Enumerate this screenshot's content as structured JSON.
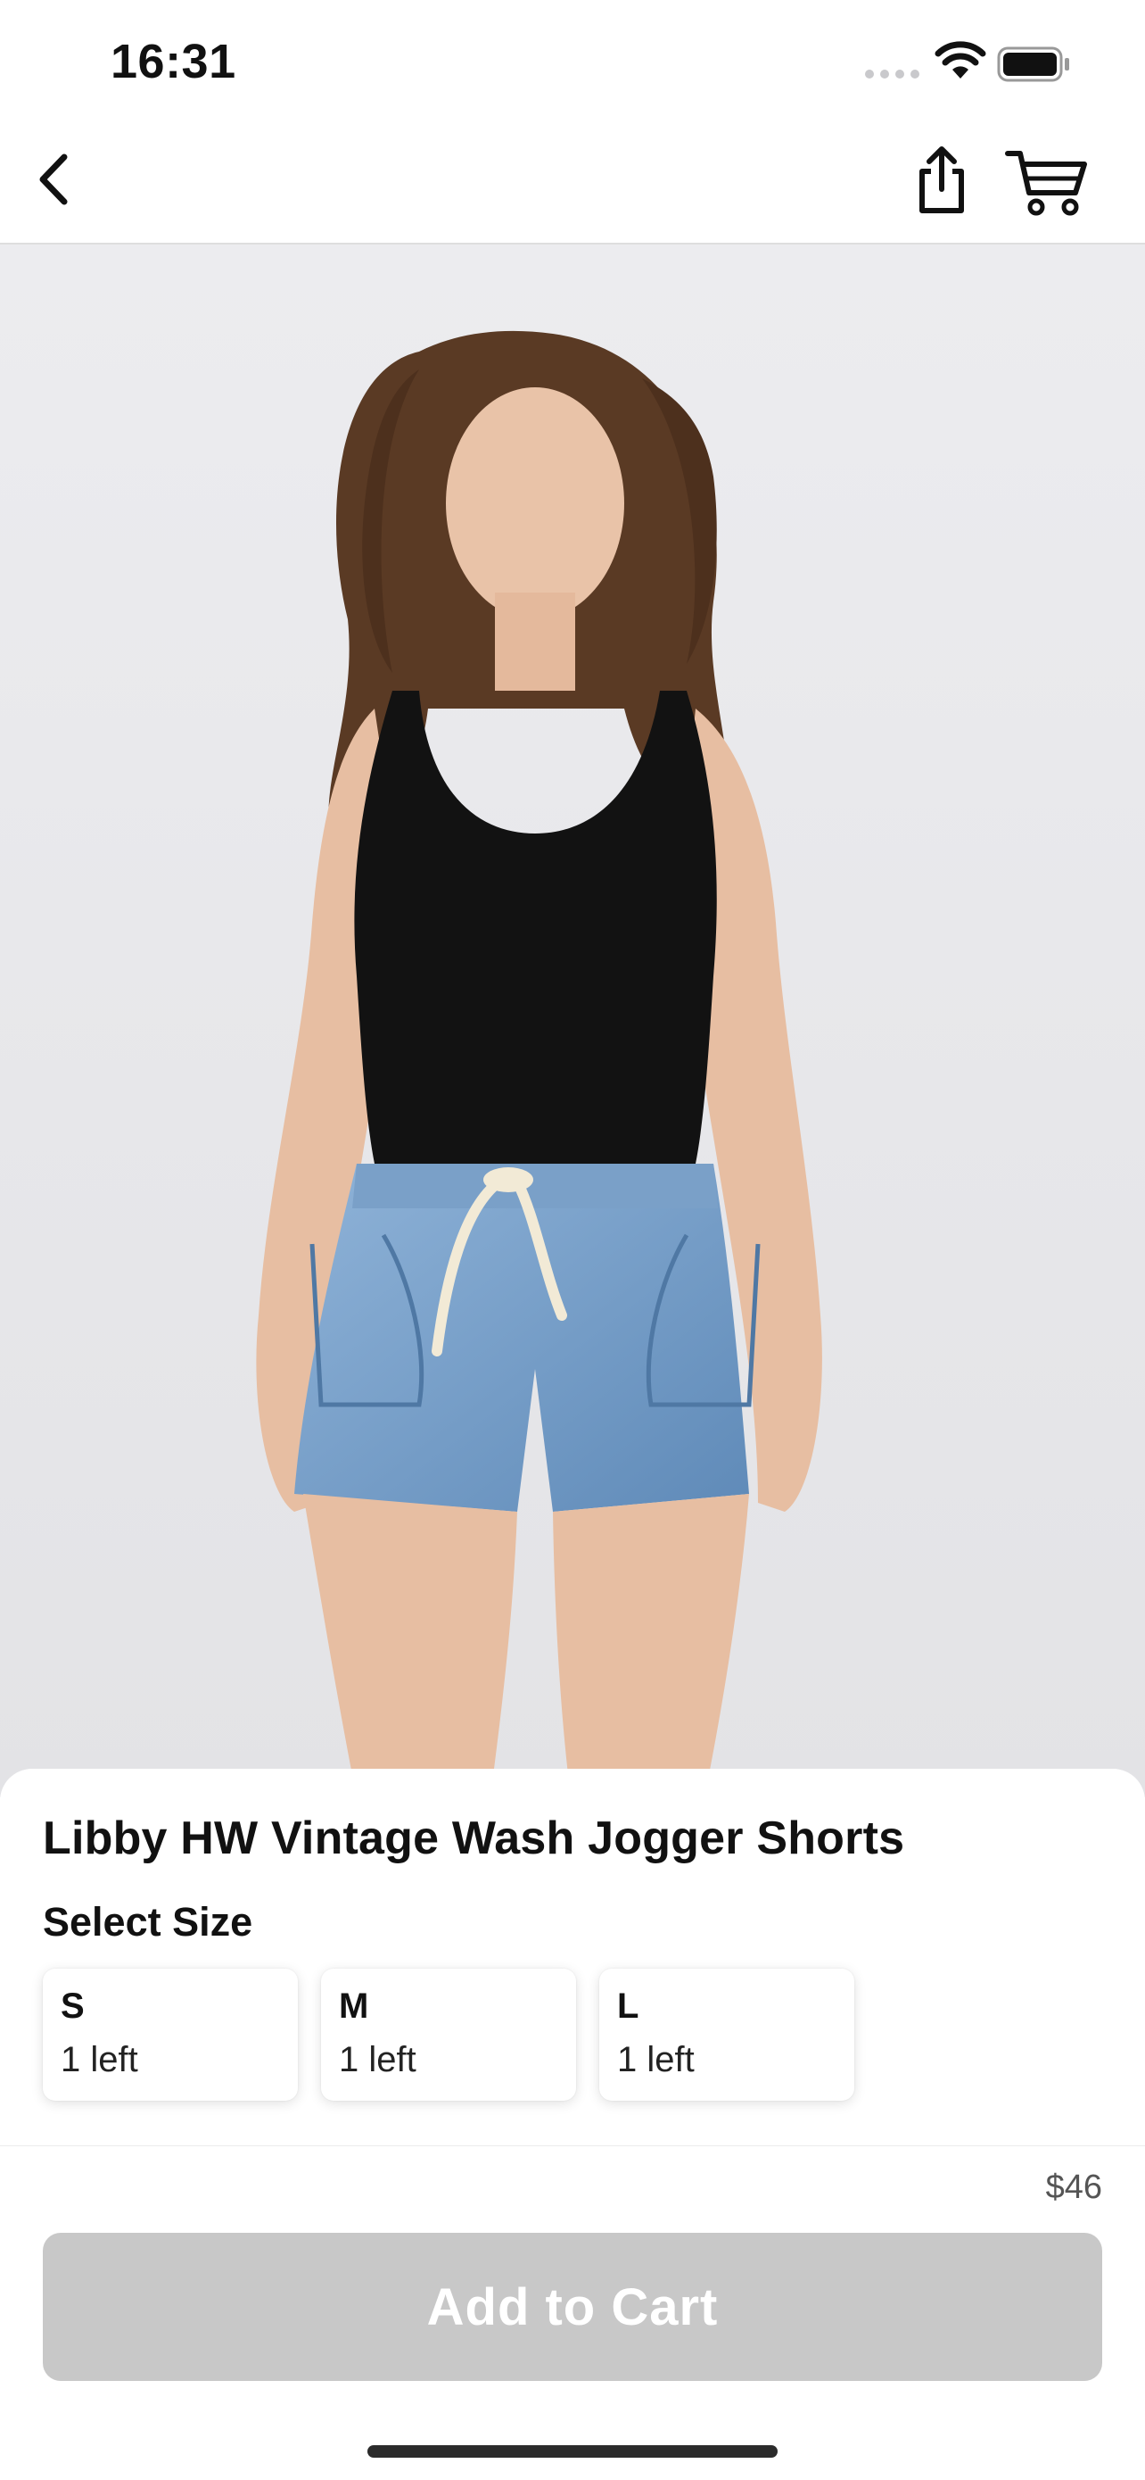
{
  "status_bar": {
    "time": "16:31"
  },
  "nav": {
    "back_icon": "chevron-left-icon",
    "share_icon": "share-icon",
    "cart_icon": "cart-icon"
  },
  "product": {
    "title": "Libby HW Vintage Wash Jogger Shorts",
    "select_size_label": "Select Size",
    "sizes": [
      {
        "size": "S",
        "stock": "1 left"
      },
      {
        "size": "M",
        "stock": "1 left"
      },
      {
        "size": "L",
        "stock": "1 left"
      }
    ],
    "price": "$46"
  },
  "actions": {
    "add_to_cart_label": "Add to Cart"
  },
  "colors": {
    "button_disabled": "#c8c8c8",
    "background": "#ffffff",
    "photo_backdrop": "#ebebee"
  }
}
